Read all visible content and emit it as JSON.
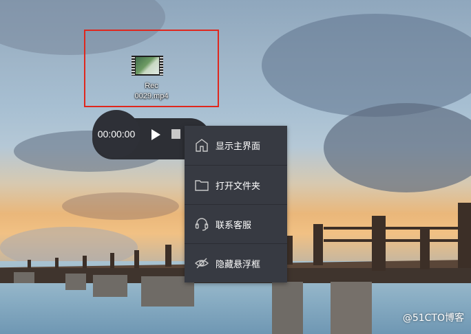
{
  "desktop": {
    "file": {
      "name_line1": "Rec",
      "name_line2": "0029.mp4",
      "icon": "video-file-icon"
    }
  },
  "recorder": {
    "timer": "00:00:00",
    "play_icon": "play-icon",
    "stop_icon": "stop-icon"
  },
  "context_menu": {
    "items": [
      {
        "label": "显示主界面",
        "icon": "home-icon"
      },
      {
        "label": "打开文件夹",
        "icon": "folder-icon"
      },
      {
        "label": "联系客服",
        "icon": "headset-icon"
      },
      {
        "label": "隐藏悬浮框",
        "icon": "eye-off-icon"
      }
    ]
  },
  "watermark": "@51CTO博客",
  "colors": {
    "highlight_border": "#e0261c",
    "menu_bg": "#373a42",
    "recorder_bg": "#2d2f35"
  }
}
